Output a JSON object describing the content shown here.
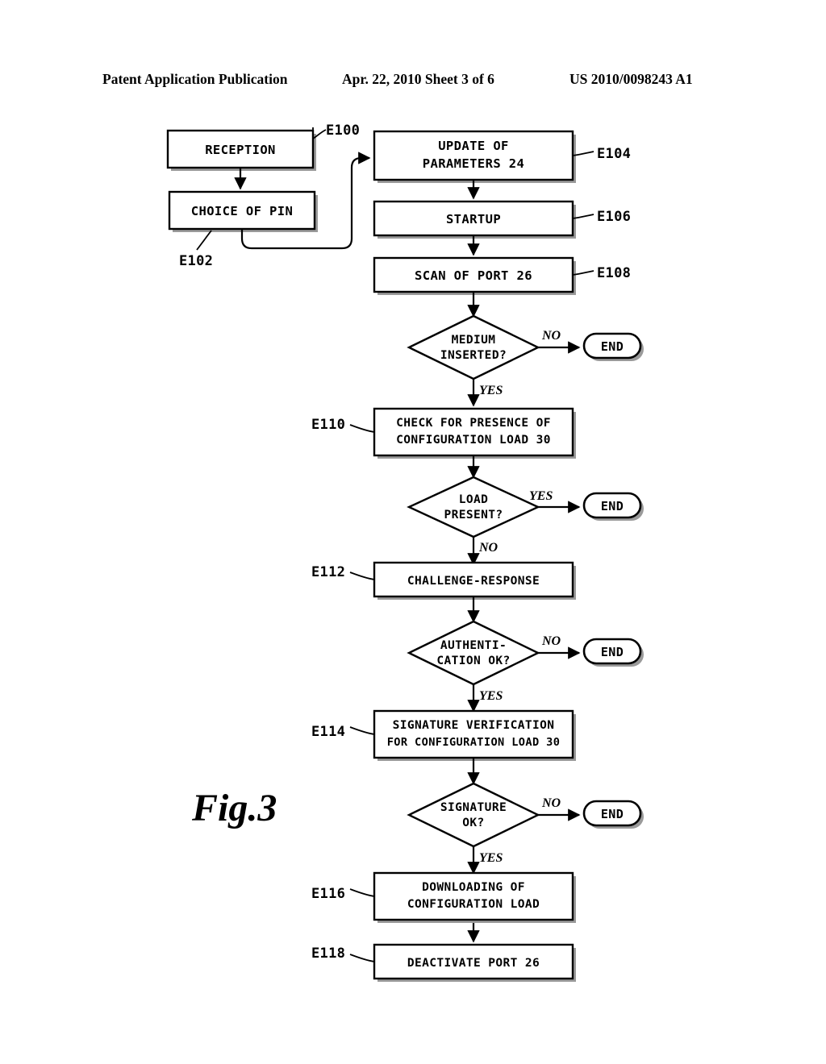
{
  "header": {
    "publication": "Patent Application Publication",
    "date_sheet": "Apr. 22, 2010  Sheet 3 of 6",
    "patent_number": "US 2010/0098243 A1"
  },
  "figure": {
    "caption": "Fig.3"
  },
  "branch_labels": {
    "yes": "YES",
    "no": "NO"
  },
  "terminals": {
    "end_1": "END",
    "end_2": "END",
    "end_3": "END",
    "end_4": "END"
  },
  "nodes": {
    "reception": {
      "ref": "E100",
      "line1": "RECEPTION"
    },
    "choice_of_pin": {
      "ref": "E102",
      "line1": "CHOICE OF PIN"
    },
    "update_parameters": {
      "ref": "E104",
      "line1": "UPDATE OF",
      "line2": "PARAMETERS 24"
    },
    "startup": {
      "ref": "E106",
      "line1": "STARTUP"
    },
    "scan_port": {
      "ref": "E108",
      "line1": "SCAN OF PORT 26"
    },
    "medium_inserted": {
      "line1": "MEDIUM",
      "line2": "INSERTED?",
      "branch_right": "NO",
      "branch_down": "YES"
    },
    "check_presence": {
      "ref": "E110",
      "line1": "CHECK FOR PRESENCE OF",
      "line2": "CONFIGURATION LOAD 30"
    },
    "load_present": {
      "line1": "LOAD",
      "line2": "PRESENT?",
      "branch_right": "YES",
      "branch_down": "NO"
    },
    "challenge_response": {
      "ref": "E112",
      "line1": "CHALLENGE-RESPONSE"
    },
    "authentication_ok": {
      "line1": "AUTHENTI-",
      "line2": "CATION OK?",
      "branch_right": "NO",
      "branch_down": "YES"
    },
    "signature_verification": {
      "ref": "E114",
      "line1": "SIGNATURE VERIFICATION",
      "line2": "FOR CONFIGURATION LOAD 30"
    },
    "signature_ok": {
      "line1": "SIGNATURE",
      "line2": "OK?",
      "branch_right": "NO",
      "branch_down": "YES"
    },
    "downloading": {
      "ref": "E116",
      "line1": "DOWNLOADING OF",
      "line2": "CONFIGURATION LOAD"
    },
    "deactivate_port": {
      "ref": "E118",
      "line1": "DEACTIVATE PORT 26"
    }
  },
  "colors": {
    "ink": "#000000",
    "paper": "#ffffff",
    "shadow": "#9a9a9a"
  }
}
